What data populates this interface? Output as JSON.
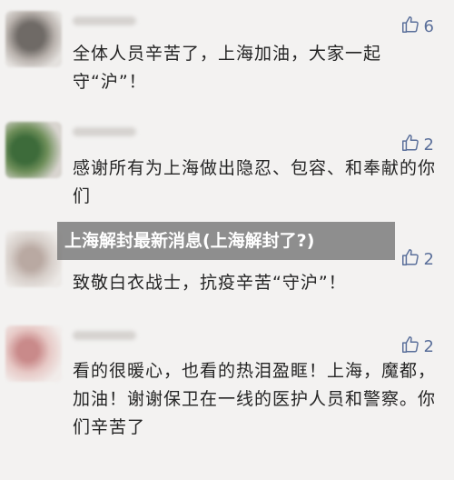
{
  "colors": {
    "background": "#f3f2f1",
    "like_accent": "#5a6f9a",
    "banner_bg": "#787878"
  },
  "banner": {
    "title": "上海解封最新消息(上海解封了?)"
  },
  "comments": [
    {
      "likes": "6",
      "text": "全体人员辛苦了，上海加油，大家一起守“沪”！"
    },
    {
      "likes": "2",
      "text": "感谢所有为上海做出隐忍、包容、和奉献的你们"
    },
    {
      "likes": "2",
      "text": "致敬白衣战士，抗疫辛苦“守沪”！"
    },
    {
      "likes": "2",
      "text": "看的很暖心，也看的热泪盈眶！上海，魔都，加油！谢谢保卫在一线的医护人员和警察。你们辛苦了"
    }
  ],
  "icons": {
    "like": "thumbs-up-icon"
  }
}
